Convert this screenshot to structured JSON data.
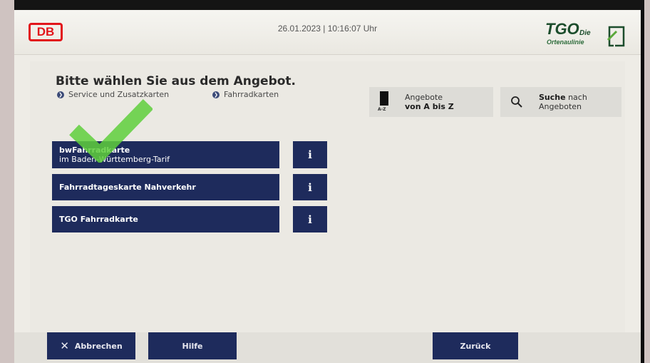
{
  "header": {
    "logo_left": "DB",
    "datetime": "26.01.2023 | 10:16:07 Uhr",
    "logo_right": {
      "main": "TGO",
      "die": "Die",
      "sub": "Ortenaulinie"
    }
  },
  "main": {
    "title": "Bitte wählen Sie aus dem Angebot.",
    "breadcrumbs": [
      {
        "label": "Service und Zusatzkarten"
      },
      {
        "label": "Fahrradkarten"
      }
    ],
    "search_buttons": {
      "az": {
        "icon_label": "A-Z",
        "line1": "Angebote",
        "line2": "von A bis Z"
      },
      "search": {
        "line1_bold": "Suche",
        "line1_rest": " nach",
        "line2": "Angeboten"
      }
    },
    "offers": [
      {
        "title": "bwFahrradkarte",
        "subtitle": "im Baden-Württemberg-Tarif",
        "info": "i"
      },
      {
        "title": "Fahrradtageskarte Nahverkehr",
        "info": "i"
      },
      {
        "title": "TGO Fahrradkarte",
        "info": "i"
      }
    ]
  },
  "footer": {
    "cancel": "Abbrechen",
    "help": "Hilfe",
    "back": "Zurück"
  },
  "colors": {
    "primary_button": "#1e2b5c",
    "db_red": "#e2151b",
    "tgo_green": "#1c4d2c",
    "checkmark_overlay": "#5fcf3c"
  }
}
